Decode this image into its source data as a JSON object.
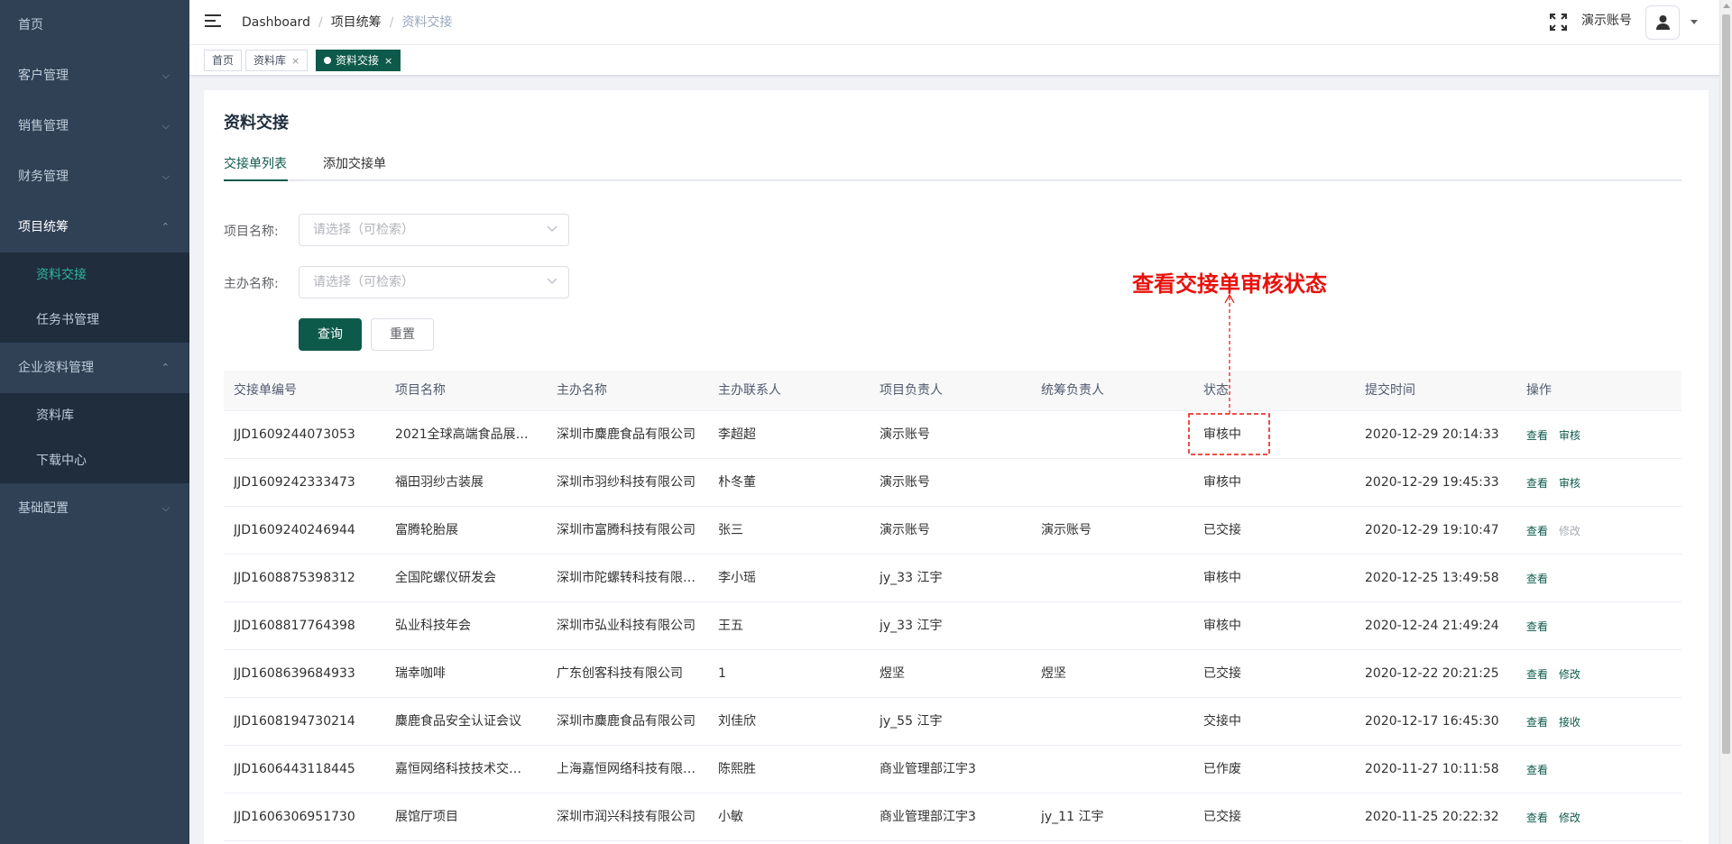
{
  "sidebar": {
    "items": [
      {
        "label": "首页"
      },
      {
        "label": "客户管理"
      },
      {
        "label": "销售管理"
      },
      {
        "label": "财务管理"
      },
      {
        "label": "项目统筹",
        "sub": [
          "资料交接",
          "任务书管理"
        ]
      },
      {
        "label": "企业资料管理",
        "sub": [
          "资料库",
          "下载中心"
        ]
      },
      {
        "label": "基础配置"
      }
    ]
  },
  "navbar": {
    "breadcrumb": [
      "Dashboard",
      "项目统筹",
      "资料交接"
    ],
    "account": "演示账号"
  },
  "tags": [
    {
      "label": "首页"
    },
    {
      "label": "资料库",
      "close": "×"
    },
    {
      "label": "资料交接",
      "close": "×"
    }
  ],
  "page": {
    "title": "资料交接",
    "tabs": [
      "交接单列表",
      "添加交接单"
    ],
    "form": {
      "project_label": "项目名称:",
      "project_placeholder": "请选择（可检索）",
      "host_label": "主办名称:",
      "host_placeholder": "请选择（可检索）",
      "search_btn": "查询",
      "reset_btn": "重置"
    }
  },
  "table": {
    "headers": [
      "交接单编号",
      "项目名称",
      "主办名称",
      "主办联系人",
      "项目负责人",
      "统筹负责人",
      "状态",
      "提交时间",
      "操作"
    ],
    "rows": [
      {
        "id": "JJD1609244073053",
        "project": "2021全球高端食品展…",
        "host": "深圳市麋鹿食品有限公司",
        "contact": "李超超",
        "pm": "演示账号",
        "coord": "",
        "status": "审核中",
        "time": "2020-12-29 20:14:33",
        "ops": [
          "查看",
          "审核"
        ]
      },
      {
        "id": "JJD1609242333473",
        "project": "福田羽纱古装展",
        "host": "深圳市羽纱科技有限公司",
        "contact": "朴冬董",
        "pm": "演示账号",
        "coord": "",
        "status": "审核中",
        "time": "2020-12-29 19:45:33",
        "ops": [
          "查看",
          "审核"
        ]
      },
      {
        "id": "JJD1609240246944",
        "project": "富腾轮胎展",
        "host": "深圳市富腾科技有限公司",
        "contact": "张三",
        "pm": "演示账号",
        "coord": "演示账号",
        "status": "已交接",
        "time": "2020-12-29 19:10:47",
        "ops": [
          "查看",
          "修改"
        ]
      },
      {
        "id": "JJD1608875398312",
        "project": "全国陀螺仪研发会",
        "host": "深圳市陀螺转科技有限…",
        "contact": "李小瑶",
        "pm": "jy_33 江宇",
        "coord": "",
        "status": "审核中",
        "time": "2020-12-25 13:49:58",
        "ops": [
          "查看"
        ]
      },
      {
        "id": "JJD1608817764398",
        "project": "弘业科技年会",
        "host": "深圳市弘业科技有限公司",
        "contact": "王五",
        "pm": "jy_33 江宇",
        "coord": "",
        "status": "审核中",
        "time": "2020-12-24 21:49:24",
        "ops": [
          "查看"
        ]
      },
      {
        "id": "JJD1608639684933",
        "project": "瑞幸咖啡",
        "host": "广东创客科技有限公司",
        "contact": "1",
        "pm": "煜坚",
        "coord": "煜坚",
        "status": "已交接",
        "time": "2020-12-22 20:21:25",
        "ops": [
          "查看",
          "修改"
        ]
      },
      {
        "id": "JJD1608194730214",
        "project": "麋鹿食品安全认证会议",
        "host": "深圳市麋鹿食品有限公司",
        "contact": "刘佳欣",
        "pm": "jy_55 江宇",
        "coord": "",
        "status": "交接中",
        "time": "2020-12-17 16:45:30",
        "ops": [
          "查看",
          "接收"
        ]
      },
      {
        "id": "JJD1606443118445",
        "project": "嘉恒网络科技技术交流会",
        "host": "上海嘉恒网络科技有限…",
        "contact": "陈熙胜",
        "pm": "商业管理部江宇3",
        "coord": "",
        "status": "已作废",
        "time": "2020-11-27 10:11:58",
        "ops": [
          "查看"
        ]
      },
      {
        "id": "JJD1606306951730",
        "project": "展馆厅项目",
        "host": "深圳市润兴科技有限公司",
        "contact": "小敏",
        "pm": "商业管理部江宇3",
        "coord": "jy_11 江宇",
        "status": "已交接",
        "time": "2020-11-25 20:22:32",
        "ops": [
          "查看",
          "修改"
        ]
      }
    ]
  },
  "annotation": {
    "text": "查看交接单审核状态",
    "color": "#e8120c"
  },
  "colors": {
    "primary": "#0e5a4a",
    "sidebar_bg": "#304156",
    "submenu_bg": "#1f2d3d",
    "active_sub": "#2cb89c"
  }
}
